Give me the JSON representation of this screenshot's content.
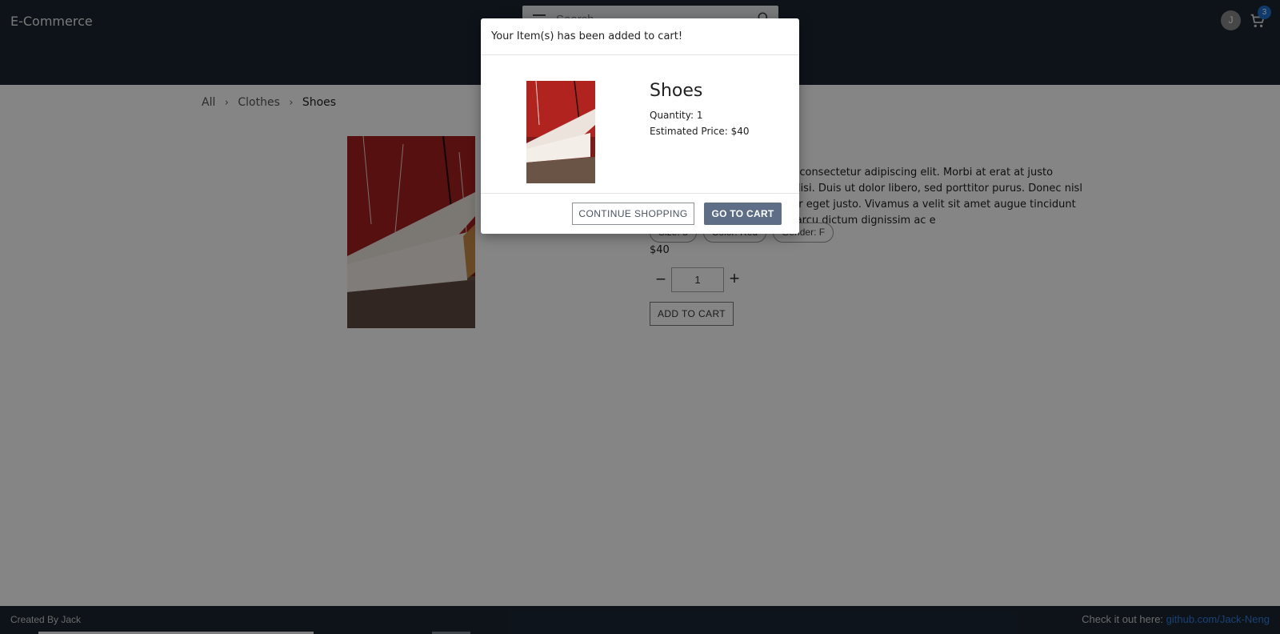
{
  "header": {
    "brand": "E-Commerce",
    "search_placeholder": "Search",
    "avatar_initial": "J",
    "cart_count": "3"
  },
  "breadcrumb": {
    "items": [
      "All",
      "Clothes",
      "Shoes"
    ]
  },
  "product": {
    "description": "Lorem ipsum dolor sit amet, consectetur adipiscing elit. Morbi at erat at justo mollis scelerisque. Nulla facilisi. Duis ut dolor libero, sed porttitor purus. Donec nisl lectus, posuere quis, pulvinar eget justo. Vivamus a velit sit amet augue tincidunt feugiat. Ut convallis magna arcu dictum dignissim ac e",
    "tags": [
      "Size: 8",
      "Color: Red",
      "Gender: F"
    ],
    "price": "$40",
    "quantity": "1",
    "add_to_cart_label": "ADD TO CART"
  },
  "modal": {
    "header": "Your Item(s) has been added to cart!",
    "item_name": "Shoes",
    "quantity_text": "Quantity: 1",
    "price_text": "Estimated Price: $40",
    "continue_label": "CONTINUE SHOPPING",
    "go_to_cart_label": "GO TO CART"
  },
  "footer": {
    "left_text": "Created By Jack",
    "right_prefix": "Check it out here: ",
    "link_text": "github.com/Jack-Neng"
  },
  "colors": {
    "header_bg": "#1b2633",
    "accent": "#5f6e87",
    "link": "#2f7ddf",
    "badge": "#1d6fce"
  }
}
